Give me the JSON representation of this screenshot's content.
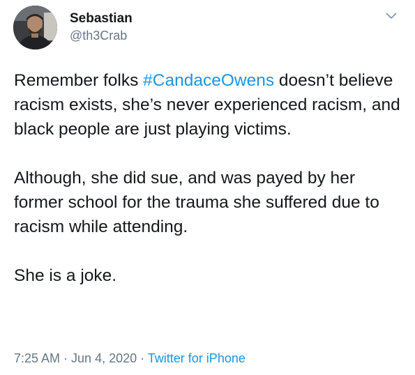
{
  "user": {
    "display_name": "Sebastian",
    "handle": "@th3Crab",
    "avatar_icon": "user-photo-avatar"
  },
  "menu": {
    "icon": "chevron-down-icon"
  },
  "tweet": {
    "paragraph1": {
      "before": "Remember folks ",
      "hashtag": "#CandaceOwens",
      "after": " doesn’t believe racism exists, she’s never experienced racism, and black people are just playing victims."
    },
    "paragraph2": "Although, she did sue, and was payed by her former school for the trauma she suffered due to racism while attending.",
    "paragraph3": "She is a joke."
  },
  "meta": {
    "time": "7:25 AM",
    "separator1": " · ",
    "date": "Jun 4, 2020",
    "separator2": " · ",
    "source": "Twitter for iPhone"
  },
  "colors": {
    "link": "#1b95e0",
    "text": "#14171a",
    "secondary": "#657786"
  }
}
